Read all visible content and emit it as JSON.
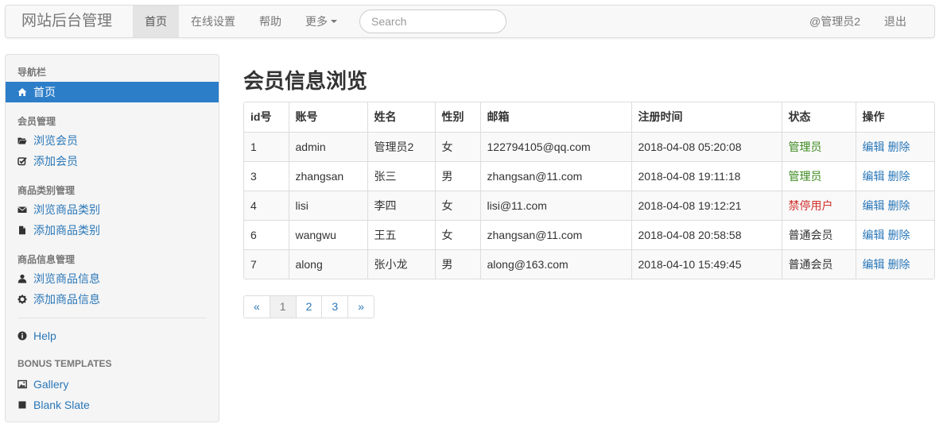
{
  "navbar": {
    "brand": "网站后台管理",
    "items": [
      {
        "label": "首页",
        "active": true
      },
      {
        "label": "在线设置"
      },
      {
        "label": "帮助"
      },
      {
        "label": "更多"
      }
    ],
    "search_placeholder": "Search",
    "user": "@管理员2",
    "logout": "退出"
  },
  "sidebar": {
    "nav_header": "导航栏",
    "home": "首页",
    "groups": [
      {
        "header": "会员管理",
        "items": [
          {
            "label": "浏览会员",
            "icon": "folder-open-icon"
          },
          {
            "label": "添加会员",
            "icon": "check-edit-icon"
          }
        ]
      },
      {
        "header": "商品类别管理",
        "items": [
          {
            "label": "浏览商品类别",
            "icon": "envelope-icon"
          },
          {
            "label": "添加商品类别",
            "icon": "file-icon"
          }
        ]
      },
      {
        "header": "商品信息管理",
        "items": [
          {
            "label": "浏览商品信息",
            "icon": "user-icon"
          },
          {
            "label": "添加商品信息",
            "icon": "gear-icon"
          }
        ]
      }
    ],
    "help": "Help",
    "bonus_header": "BONUS TEMPLATES",
    "gallery": "Gallery",
    "blank_slate": "Blank Slate"
  },
  "main": {
    "title": "会员信息浏览",
    "columns": [
      "id号",
      "账号",
      "姓名",
      "性别",
      "邮箱",
      "注册时间",
      "状态",
      "操作"
    ],
    "rows": [
      {
        "id": "1",
        "account": "admin",
        "name": "管理员2",
        "gender": "女",
        "email": "122794105@qq.com",
        "time": "2018-04-08 05:20:08",
        "status": "管理员",
        "status_type": "admin"
      },
      {
        "id": "3",
        "account": "zhangsan",
        "name": "张三",
        "gender": "男",
        "email": "zhangsan@11.com",
        "time": "2018-04-08 19:11:18",
        "status": "管理员",
        "status_type": "admin"
      },
      {
        "id": "4",
        "account": "lisi",
        "name": "李四",
        "gender": "女",
        "email": "lisi@11.com",
        "time": "2018-04-08 19:12:21",
        "status": "禁停用户",
        "status_type": "banned"
      },
      {
        "id": "6",
        "account": "wangwu",
        "name": "王五",
        "gender": "女",
        "email": "zhangsan@11.com",
        "time": "2018-04-08 20:58:58",
        "status": "普通会员",
        "status_type": "normal"
      },
      {
        "id": "7",
        "account": "along",
        "name": "张小龙",
        "gender": "男",
        "email": "along@163.com",
        "time": "2018-04-10 15:49:45",
        "status": "普通会员",
        "status_type": "normal"
      }
    ],
    "edit_label": "编辑",
    "delete_label": "删除",
    "pagination": {
      "prev": "«",
      "pages": [
        "1",
        "2",
        "3"
      ],
      "next": "»",
      "current": "1"
    }
  }
}
